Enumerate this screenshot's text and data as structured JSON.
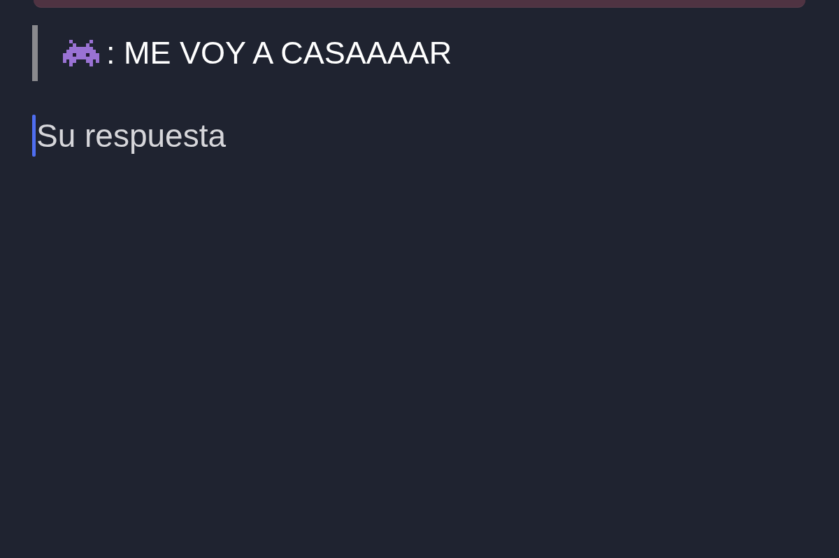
{
  "quote": {
    "text": ": ME VOY A CASAAAAR"
  },
  "answer": {
    "placeholder": "Su respuesta",
    "focused": true
  }
}
